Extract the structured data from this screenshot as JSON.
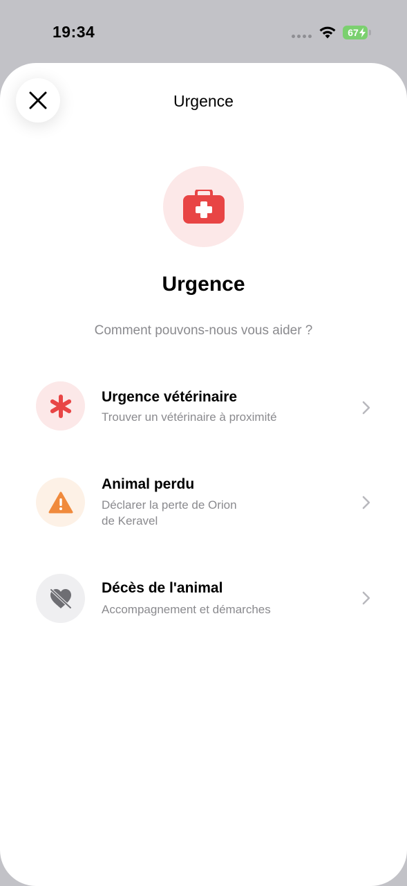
{
  "status": {
    "time": "19:34",
    "battery": "67"
  },
  "header": {
    "title": "Urgence"
  },
  "hero": {
    "title": "Urgence",
    "subtitle": "Comment pouvons-nous vous aider ?"
  },
  "options": [
    {
      "title": "Urgence vétérinaire",
      "subtitle": "Trouver un vétérinaire à proximité",
      "icon": "asterisk-icon",
      "color": "#e84545",
      "bg": "#fce8e8"
    },
    {
      "title": "Animal perdu",
      "subtitle_line1": "Déclarer la perte de Orion",
      "subtitle_line2": "de Keravel",
      "icon": "warning-icon",
      "color": "#f08a3c",
      "bg": "#fdf1e6"
    },
    {
      "title": "Décès de l'animal",
      "subtitle": "Accompagnement et démarches",
      "icon": "broken-heart-icon",
      "color": "#6e6e73",
      "bg": "#efeff1"
    }
  ],
  "colors": {
    "accent": "#e84545",
    "hero_bg": "#fce8e8"
  }
}
